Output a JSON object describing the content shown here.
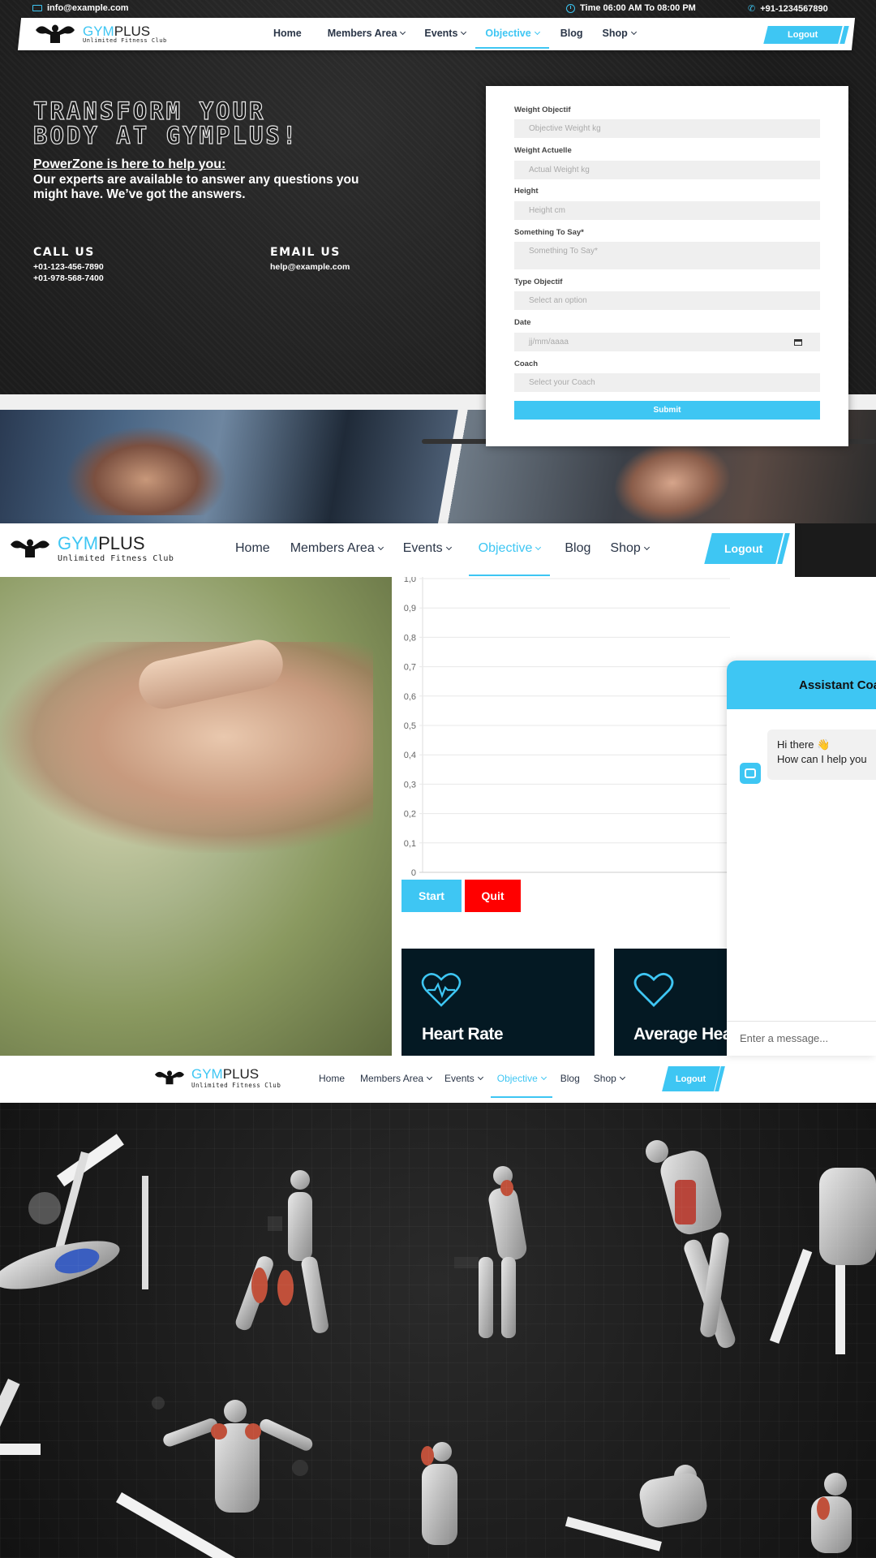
{
  "brand": {
    "gym": "GYM",
    "plus": "PLUS",
    "tagline": "Unlimited Fitness Club"
  },
  "topbar": {
    "email": "info@example.com",
    "hours": "Time 06:00 AM To 08:00 PM",
    "phone": "+91-1234567890"
  },
  "nav": {
    "items": [
      "Home",
      "Members Area",
      "Events",
      "Objective",
      "Blog",
      "Shop"
    ],
    "active": "Objective",
    "logout": "Logout"
  },
  "hero": {
    "title_line1": "TRANSFORM YOUR",
    "title_line2": "BODY AT GYMPLUS!",
    "subtitle": "PowerZone is here to help you:",
    "paragraph": "Our experts are available to answer any questions you might have. We’ve got the answers.",
    "call_heading": "CALL US",
    "phone1": "+01-123-456-7890",
    "phone2": "+01-978-568-7400",
    "email_heading": "EMAIL US",
    "email": "help@example.com"
  },
  "form": {
    "weight_objective_label": "Weight Objectif",
    "weight_objective_placeholder": "Objective Weight kg",
    "weight_current_label": "Weight Actuelle",
    "weight_current_placeholder": "Actual Weight kg",
    "height_label": "Height",
    "height_placeholder": "Height cm",
    "message_label": "Something To Say*",
    "message_placeholder": "Something To Say*",
    "type_label": "Type Objectif",
    "type_placeholder": "Select an option",
    "date_label": "Date",
    "date_placeholder": "jj/mm/aaaa",
    "coach_label": "Coach",
    "coach_placeholder": "Select your Coach",
    "submit": "Submit"
  },
  "chart_data": {
    "type": "line",
    "ylim": [
      0,
      1
    ],
    "yticks": [
      "0",
      "0,1",
      "0,2",
      "0,3",
      "0,4",
      "0,5",
      "0,6",
      "0,7",
      "0,8",
      "0,9",
      "1,0"
    ],
    "series": [],
    "grid": true
  },
  "controls": {
    "start": "Start",
    "quit": "Quit"
  },
  "cards": [
    {
      "title": "Heart Rate",
      "icon": "heart-pulse-icon"
    },
    {
      "title": "Average Heart",
      "icon": "heart-icon"
    }
  ],
  "chat": {
    "title": "Assistant Coach",
    "greeting": "Hi there 👋",
    "question": "How can I help you",
    "input_placeholder": "Enter a message..."
  },
  "colors": {
    "accent": "#3ec6f3",
    "quit": "#ff0000",
    "card_bg": "#041923",
    "nav_text": "#2a3547"
  }
}
